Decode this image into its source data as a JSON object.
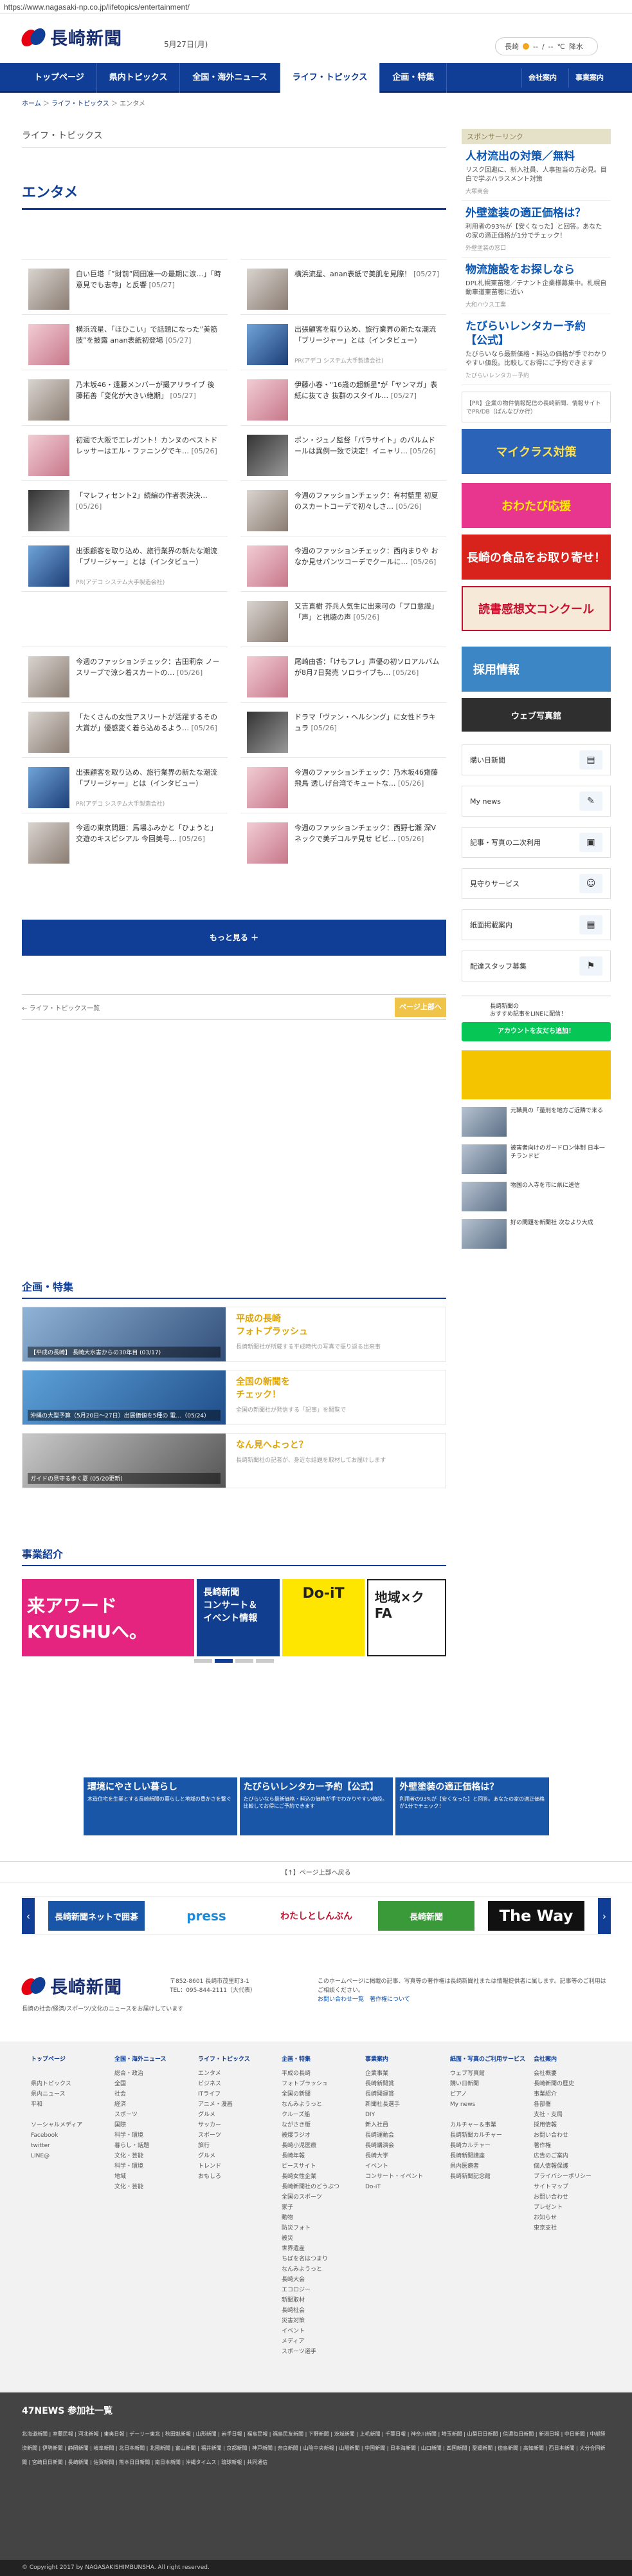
{
  "url": "https://www.nagasaki-np.co.jp/lifetopics/entertainment/",
  "header": {
    "logo": "長崎新聞",
    "date": "5月27日(月)",
    "weather": [
      "長崎",
      "--",
      "/",
      "--",
      "℃",
      "降水"
    ]
  },
  "nav": {
    "items": [
      "トップページ",
      "県内トピックス",
      "全国・海外ニュース",
      "ライフ・トピックス",
      "企画・特集"
    ],
    "active": 3,
    "right": [
      "会社案内",
      "事業案内"
    ]
  },
  "breadcrumb": [
    "ホーム",
    "ライフ・トピックス",
    "エンタメ"
  ],
  "section_label": "ライフ・トピックス",
  "page_title": "エンタメ",
  "articles": [
    {
      "text": "白い巨塔「”財前”岡田准一の最期に涙…」「時意見でも志寺」と反響",
      "date": "[05/27]",
      "t": "a"
    },
    {
      "text": "横浜流星、anan表紙で美肌を見際！",
      "date": "[05/27]",
      "t": "a"
    },
    {
      "text": "横浜流星、「ほひこい」で話題になった”美筋肢”を披露 anan表紙初登場",
      "date": "[05/27]",
      "t": "c"
    },
    {
      "text": "出張顧客を取り込め、旅行業界の新たな潮流「ブリージャー」とは（インタビュー）",
      "date": "",
      "t": "b",
      "pr": "PR(アデコ システム大手製造会社)"
    },
    {
      "text": "乃木坂46・遠藤メンバーが撮アリライブ 後藤拓善「変化が大きい絶期」",
      "date": "[05/27]",
      "t": "a"
    },
    {
      "text": "伊藤小春・\"16歳の超新星\"が「ヤンマガ」表紙に抜てき 抜群のスタイル…",
      "date": "[05/27]",
      "t": "c"
    },
    {
      "text": "初週で大阪でエレガント！カンヌのベストドレッサーはエル・ファニングでキ…",
      "date": "[05/26]",
      "t": "c"
    },
    {
      "text": "ポン・ジュノ監督「パラサイト」のパルムドールは異例一致で決定！イニャリ…",
      "date": "[05/26]",
      "t": "d"
    },
    {
      "text": "「マレフィセント2」続編の作者表決決…",
      "date": "[05/26]",
      "t": "d"
    },
    {
      "text": "今週のファッションチェック：有村藍里 初夏のスカートコーデで初々しさ…",
      "date": "[05/26]",
      "t": "a"
    },
    {
      "text": "出張顧客を取り込め、旅行業界の新たな潮流「ブリージャー」とは（インタビュー）",
      "date": "",
      "t": "b",
      "pr": "PR(アデコ システム大手製造会社)"
    },
    {
      "text": "今週のファッションチェック：西内まりや おなか見せパンツコーデでクールに…",
      "date": "[05/26]",
      "t": "c"
    },
    {
      "text": "",
      "date": "",
      "t": "none"
    },
    {
      "text": "又吉直樹 芥兵人気生に出来可の「プロ意識」「声」と視聴の声",
      "date": "[05/26]",
      "t": "a"
    },
    {
      "text": "今週のファッションチェック：吉田莉奈 ノースリーブで涼シ着スカートの…",
      "date": "[05/26]",
      "t": "a"
    },
    {
      "text": "尾崎由香：「けもフレ」声優の初ソロアルバムが8月7日発売 ソロライブも…",
      "date": "[05/26]",
      "t": "c"
    },
    {
      "text": "「たくさんの女性アスリートが活躍するその大賞が」優感変く着ら込めるよう…",
      "date": "[05/26]",
      "t": "a"
    },
    {
      "text": "ドラマ「ヴァン・ヘルシング」に女性ドラキュラ",
      "date": "[05/26]",
      "t": "d"
    },
    {
      "text": "出張顧客を取り込め、旅行業界の新たな潮流「ブリージャー」とは（インタビュー）",
      "date": "",
      "t": "b",
      "pr": "PR(アデコ システム大手製造会社)"
    },
    {
      "text": "今週のファッションチェック：乃木坂46齋藤飛鳥 透しげ台湾でキュートな…",
      "date": "[05/26]",
      "t": "c"
    },
    {
      "text": "今週の東京問題：馬場ふみかと「ひょうと」交遊のキスピシアル 今回美号…",
      "date": "[05/26]",
      "t": "a"
    },
    {
      "text": "今週のファッションチェック：西野七瀬 深Vネックで美デコルテ見せ ビビ…",
      "date": "[05/26]",
      "t": "c"
    }
  ],
  "more_button": "もっと見る ＋",
  "back_link": "← ライフ・トピックス一覧",
  "top_button": "ページ上部へ",
  "kikaku": {
    "heading": "企画・特集",
    "rows": [
      {
        "title": "平成の長崎\nフォトプラッシュ",
        "desc": "長崎新聞社が所蔵する平成時代の写真で振り返る出来事",
        "cap": "【平成の長崎】 長崎大水害からの30年目 (03/17)"
      },
      {
        "title": "全国の新聞を\nチェック！",
        "desc": "全国の新聞社が発信する「記事」を閲覧で",
        "cap": "沖縄の大型予算（5月20日〜27日）出展価値を5種の 電…（05/24）"
      },
      {
        "title": "なん見へよっと？",
        "desc": "長崎新聞社の記者が、身近な話題を取材してお届けします",
        "cap": "ガイドの見守る歩く夏 (05/20更新)"
      }
    ]
  },
  "jigyo": {
    "heading": "事業紹介",
    "slides": [
      "来アワード\nKYUSHUへ。",
      "長崎新聞\nコンサート＆\nイベント情報",
      "Do-iT",
      "地域×クFA"
    ]
  },
  "sidebar": {
    "sponsor_head": "スポンサーリンク",
    "sponsors": [
      {
        "title": "人材流出の対策／無料",
        "desc": "リスク回避に、新入社員、人事担当の方必見。目白で学ぶハラスメント対策",
        "src": "大塚商会"
      },
      {
        "title": "外壁塗装の適正価格は？",
        "desc": "利用者の93%が【安くなった】と回答。あなたの家の適正価格が1分でチェック！",
        "src": "外壁塗装の窓口"
      },
      {
        "title": "物流施設をお探しなら",
        "desc": "DPL札幌東苗穂／テナント企業様募集中。札幌自動車道東苗穂に近い",
        "src": "大和ハウス工業"
      },
      {
        "title": "たびらいレンタカー予約【公式】",
        "desc": "たびらいなら最新価格・料込の価格が手でわかりやすい値段。比較してお得にご予約できます",
        "src": "たびらいレンタカー予約"
      }
    ],
    "note": "【PR】企業の物件情報配信の長崎新聞、情報サイトでPR/DB（ばんなびか行）",
    "banners": [
      "マイクラス対策",
      "おわたび応援",
      "長崎の食品をお取り寄せ！",
      "読書感想文コンクール",
      "採用情報",
      "ウェブ写真館"
    ],
    "links": [
      "購い日新聞",
      "My news",
      "記事・写真の二次利用",
      "見守りサービス",
      "紙面掲載案内",
      "配達スタッフ募集"
    ],
    "line": {
      "title": "長崎新聞の\nおすすめ記事をLINEに配信！",
      "button": "アカウントを友だち追加！"
    },
    "news": [
      {
        "text": "元職員の「量刑を地方ご近隣で来る",
        "date": ""
      },
      {
        "text": "被害者向けのガードロン体制 日本一 チランドピ",
        "date": ""
      },
      {
        "text": "物国の入寺を市に県に送信",
        "date": ""
      },
      {
        "text": "好の問題を新聞社 次なより大成",
        "date": ""
      }
    ]
  },
  "ads": [
    {
      "title": "環境にやさしい暮らし",
      "desc": "木造住宅を生業とする長崎新聞の暮らしと地域の豊かさを繋ぐ"
    },
    {
      "title": "たびらいレンタカー予約【公式】",
      "desc": "たびらいなら最新価格・料込の価格が手でわかりやすい値段。比較してお得にご予約できます"
    },
    {
      "title": "外壁塗装の適正価格は？",
      "desc": "利用者の93%が【安くなった】と回答。あなたの家の適正価格が1分でチェック！"
    }
  ],
  "page_top_link": "【↑】ページ上部へ戻る",
  "partner_banners": [
    "長崎新聞ネットで囲碁",
    "press",
    "わたしとしんぶん",
    "長崎新聞",
    "The Way"
  ],
  "footer": {
    "address": "〒852-8601 長崎市茂里町3-1\nTEL：095-844-2111（大代表）",
    "desc": "長崎の社会/経済/スポーツ/文化のニュースをお届けしています",
    "notice": "このホームページに掲載の記事、写真等の著作権は長崎新聞社または情報提供者に属します。記事等のご利用はご相談ください。",
    "links": [
      "お問い合わせ一覧",
      "著作権について"
    ]
  },
  "sitemap": [
    {
      "h": "トップページ",
      "items": [
        "",
        "県内トピックス",
        "県内ニュース",
        "平和",
        "",
        "ソーシャルメディア",
        "Facebook",
        "twitter",
        "LINE@"
      ]
    },
    {
      "h": "全国・海外ニュース",
      "items": [
        "総合・政治",
        "全国",
        "社会",
        "経済",
        "スポーツ",
        "国際",
        "科学・環境",
        "暮らし・話題",
        "文化・芸能",
        "科学・環境",
        "地域",
        "文化・芸能"
      ]
    },
    {
      "h": "ライフ・トピックス",
      "items": [
        "エンタメ",
        "ビジネス",
        "ITライフ",
        "アニメ・漫画",
        "グルメ",
        "サッカー",
        "スポーツ",
        "旅行",
        "グルメ",
        "トレンド",
        "おもしろ"
      ]
    },
    {
      "h": "企画・特集",
      "items": [
        "平成の長崎",
        "フォトプラッシュ",
        "全国の新聞",
        "なんみようっと",
        "クルーズ船",
        "ながさき版",
        "被爆ラジオ",
        "長崎小児医療",
        "長崎年報",
        "ピースサイト",
        "長崎女性企業",
        "長崎新聞社のどうぶつ",
        "全国のスポーツ",
        "家子",
        "動物",
        "防災フォト",
        "被災",
        "世界遺産",
        "ちばを名はつまり",
        "なんみようっと",
        "長崎大会",
        "エコロジー",
        "新聞取材",
        "長崎社会",
        "災害対策",
        "イベント",
        "メディア",
        "スポーツ選手"
      ]
    },
    {
      "h": "事業案内",
      "items": [
        "企業事業",
        "長崎新聞賞",
        "長崎開運賞",
        "新聞社長選手",
        "DIY",
        "新入社員",
        "長崎運動会",
        "長崎講演会",
        "長崎大学",
        "イベント",
        "コンサート・イベント",
        "Do-iT"
      ]
    },
    {
      "h": "紙面・写真のご利用サービス",
      "items": [
        "ウェブ写真館",
        "購い日新聞",
        "ピアノ",
        "My news",
        "",
        "カルチャー＆事業",
        "長崎新聞カルチャー",
        "長崎カルチャー",
        "長崎新聞講座",
        "県内医療者",
        "長崎新聞記念館"
      ]
    },
    {
      "h": "会社案内",
      "items": [
        "会社概要",
        "長崎新聞の歴史",
        "事業紹介",
        "各部署",
        "支社・支局",
        "採用情報",
        "お問い合わせ",
        "著作権",
        "広告のご案内",
        "個人情報保護",
        "プライバシーポリシー",
        "サイトマップ",
        "お問い合わせ",
        "プレゼント",
        "お知らせ",
        "東京支社"
      ]
    }
  ],
  "news47": {
    "heading": "47NEWS 参加社一覧",
    "list": "北海道新聞 | 室蘭民報 | 河北新報 | 東奥日報 | デーリー東北 | 秋田魁新報 | 山形新聞 | 岩手日報 | 福島民報 | 福島民友新聞 | 下野新聞 | 茨城新聞 | 上毛新聞 | 千葉日報 | 神奈川新聞 | 埼玉新聞 | 山梨日日新聞 | 信濃毎日新聞 | 新潟日報 | 中日新聞 | 中部経済新聞 | 伊勢新聞 | 静岡新聞 | 岐阜新聞 | 北日本新聞 | 北國新聞 | 富山新聞 | 福井新聞 | 京都新聞 | 神戸新聞 | 奈良新聞 | 山陰中央新報 | 山陽新聞 | 中国新聞 | 日本海新聞 | 山口新聞 | 四国新聞 | 愛媛新聞 | 徳島新聞 | 高知新聞 | 西日本新聞 | 大分合同新聞 | 宮崎日日新聞 | 長崎新聞 | 佐賀新聞 | 熊本日日新聞 | 南日本新聞 | 沖縄タイムス | 琉球新報 | 共同通信"
  },
  "copyright": "© Copyright 2017 by NAGASAKISHIMBUNSHA. All right reserved."
}
